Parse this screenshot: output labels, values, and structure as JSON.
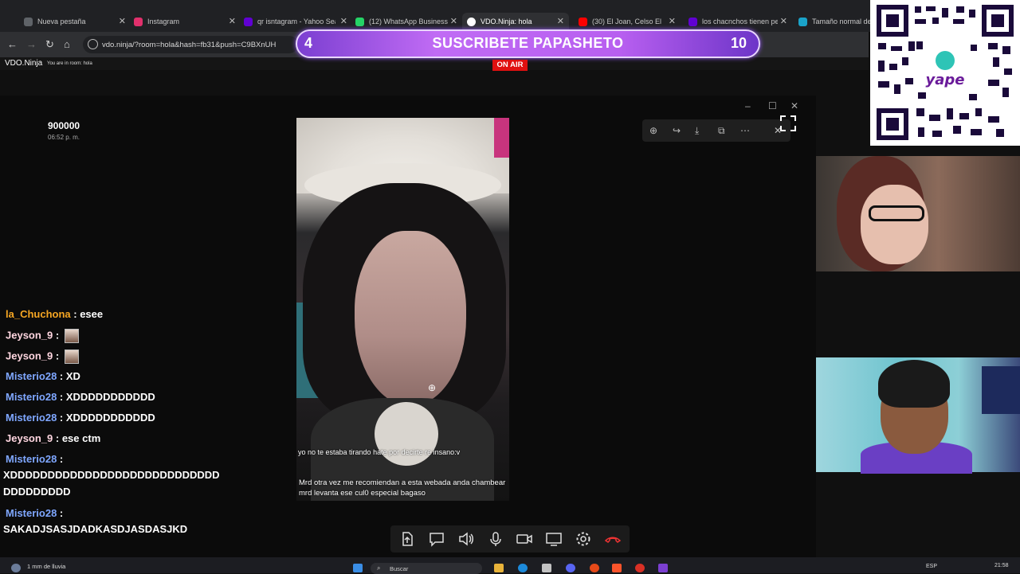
{
  "browser": {
    "tabs": [
      {
        "title": "Nueva pestaña",
        "favicon_color": "#5f6368"
      },
      {
        "title": "Instagram",
        "favicon_color": "#e1306c"
      },
      {
        "title": "qr isntagram - Yahoo Sea",
        "favicon_color": "#6001d2"
      },
      {
        "title": "(12) WhatsApp Business",
        "favicon_color": "#25d366"
      },
      {
        "title": "VDO.Ninja: hola",
        "favicon_color": "#ffffff"
      },
      {
        "title": "(30) El Joan, Celso El F",
        "favicon_color": "#ff0000"
      },
      {
        "title": "los chacnchos tienen pen",
        "favicon_color": "#6001d2"
      },
      {
        "title": "Tamaño normal del p",
        "favicon_color": "#1aa3c9"
      }
    ],
    "url": "vdo.ninja/?room=hola&hash=fb31&push=C9BXnUH"
  },
  "vdo": {
    "logo": "VDO.Ninja",
    "room_text": "You are in room: hola"
  },
  "overlay": {
    "banner_left": "4",
    "banner_title": "SUSCRIBETE PAPASHETO",
    "banner_right": "10",
    "on_air": "ON AIR",
    "qr_label": "yape"
  },
  "stream": {
    "counter": "900000",
    "counter_time": "06:52 p. m.",
    "caption_top": "yo no te estaba tirando hate por decirte re insano:v",
    "caption_bottom": "Mrd otra vez me recomiendan a esta webada anda chambear mrd levanta ese cul0 especial bagaso"
  },
  "chat": [
    {
      "user": "la_Chuchona",
      "color": "#f5a623",
      "msg": "esee"
    },
    {
      "user": "Jeyson_9",
      "color": "#ffd6e0",
      "msg": "",
      "emote": true
    },
    {
      "user": "Jeyson_9",
      "color": "#ffd6e0",
      "msg": "",
      "emote": true
    },
    {
      "user": "Misterio28",
      "color": "#7fa7ff",
      "msg": "XD"
    },
    {
      "user": "Misterio28",
      "color": "#7fa7ff",
      "msg": "XDDDDDDDDDDD"
    },
    {
      "user": "Misterio28",
      "color": "#7fa7ff",
      "msg": "XDDDDDDDDDDD"
    },
    {
      "user": "Jeyson_9",
      "color": "#ffd6e0",
      "msg": "ese ctm"
    },
    {
      "user": "Misterio28",
      "color": "#7fa7ff",
      "msg": ""
    },
    {
      "user": "Misterio28",
      "color": "#7fa7ff",
      "msg": ""
    }
  ],
  "chat_continuations": [
    "XDDDDDDDDDDDDDDDDDDDDDDDDDDDD",
    "DDDDDDDDD",
    "SAKADJSASJDADKASDJASDASJKD"
  ],
  "controls": [
    "share-file-icon",
    "chat-icon",
    "speaker-icon",
    "microphone-icon",
    "camera-icon",
    "screen-share-icon",
    "settings-icon",
    "hangup-icon"
  ],
  "taskbar": {
    "weather": "1 mm de lluvia",
    "search": "Buscar",
    "lang": "ESP",
    "time": "21:58"
  }
}
